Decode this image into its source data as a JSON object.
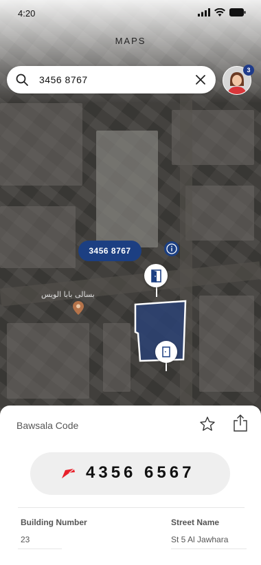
{
  "status_bar": {
    "time": "4:20"
  },
  "header": {
    "title": "MAPS"
  },
  "search": {
    "value": "3456 8767"
  },
  "profile": {
    "notification_count": "3"
  },
  "map": {
    "selected_code": "3456 8767",
    "poi_label": "بسالى بابا الويس",
    "colors": {
      "accent": "#1c3f82",
      "building": "#2c4274"
    }
  },
  "sheet": {
    "title": "Bawsala Code",
    "code": "4356 6567",
    "accent_arrow_color": "#e8202a",
    "building_number_label": "Building Number",
    "building_number": "23",
    "street_name_label": "Street Name",
    "street_name": "St 5 Al Jawhara"
  }
}
